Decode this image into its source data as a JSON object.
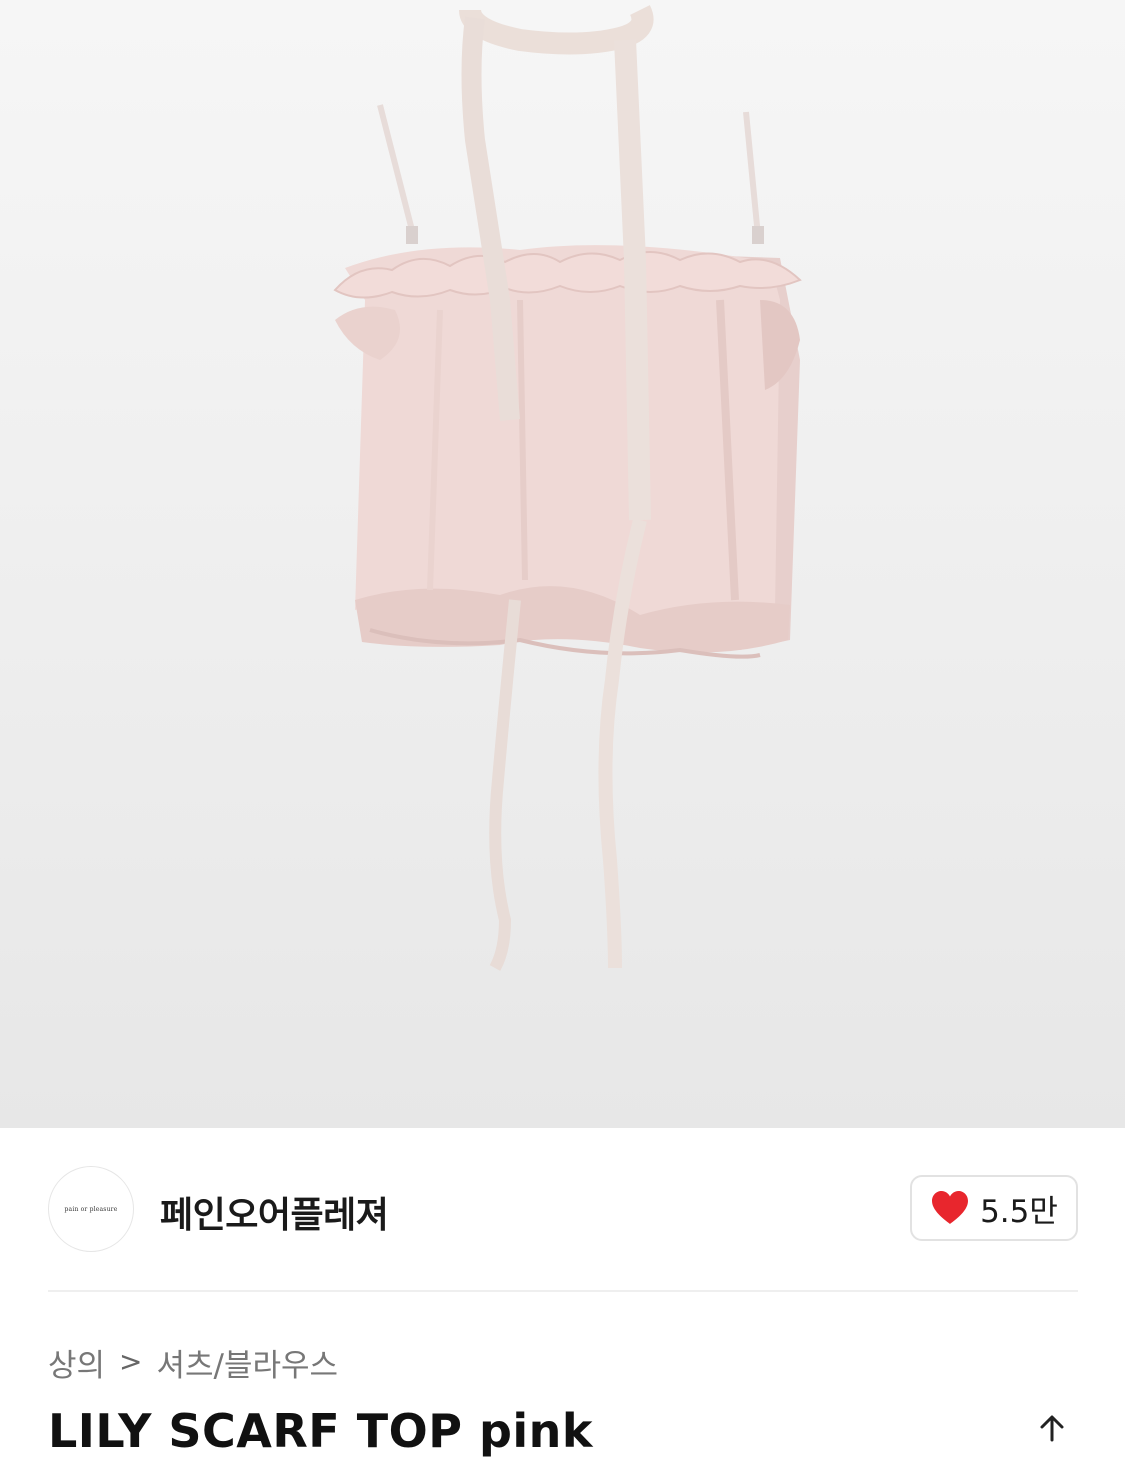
{
  "product_image": {
    "alt": "LILY SCARF TOP pink product photo"
  },
  "brand": {
    "logo_text": "pain or pleasure",
    "name": "페인오어플레져"
  },
  "like": {
    "icon": "heart-icon",
    "count": "5.5만",
    "color": "#e8262d"
  },
  "breadcrumb": {
    "category": "상의",
    "separator": ">",
    "subcategory": "셔츠/블라우스"
  },
  "product": {
    "title": "LILY SCARF TOP pink"
  },
  "share": {
    "icon": "share-icon"
  }
}
